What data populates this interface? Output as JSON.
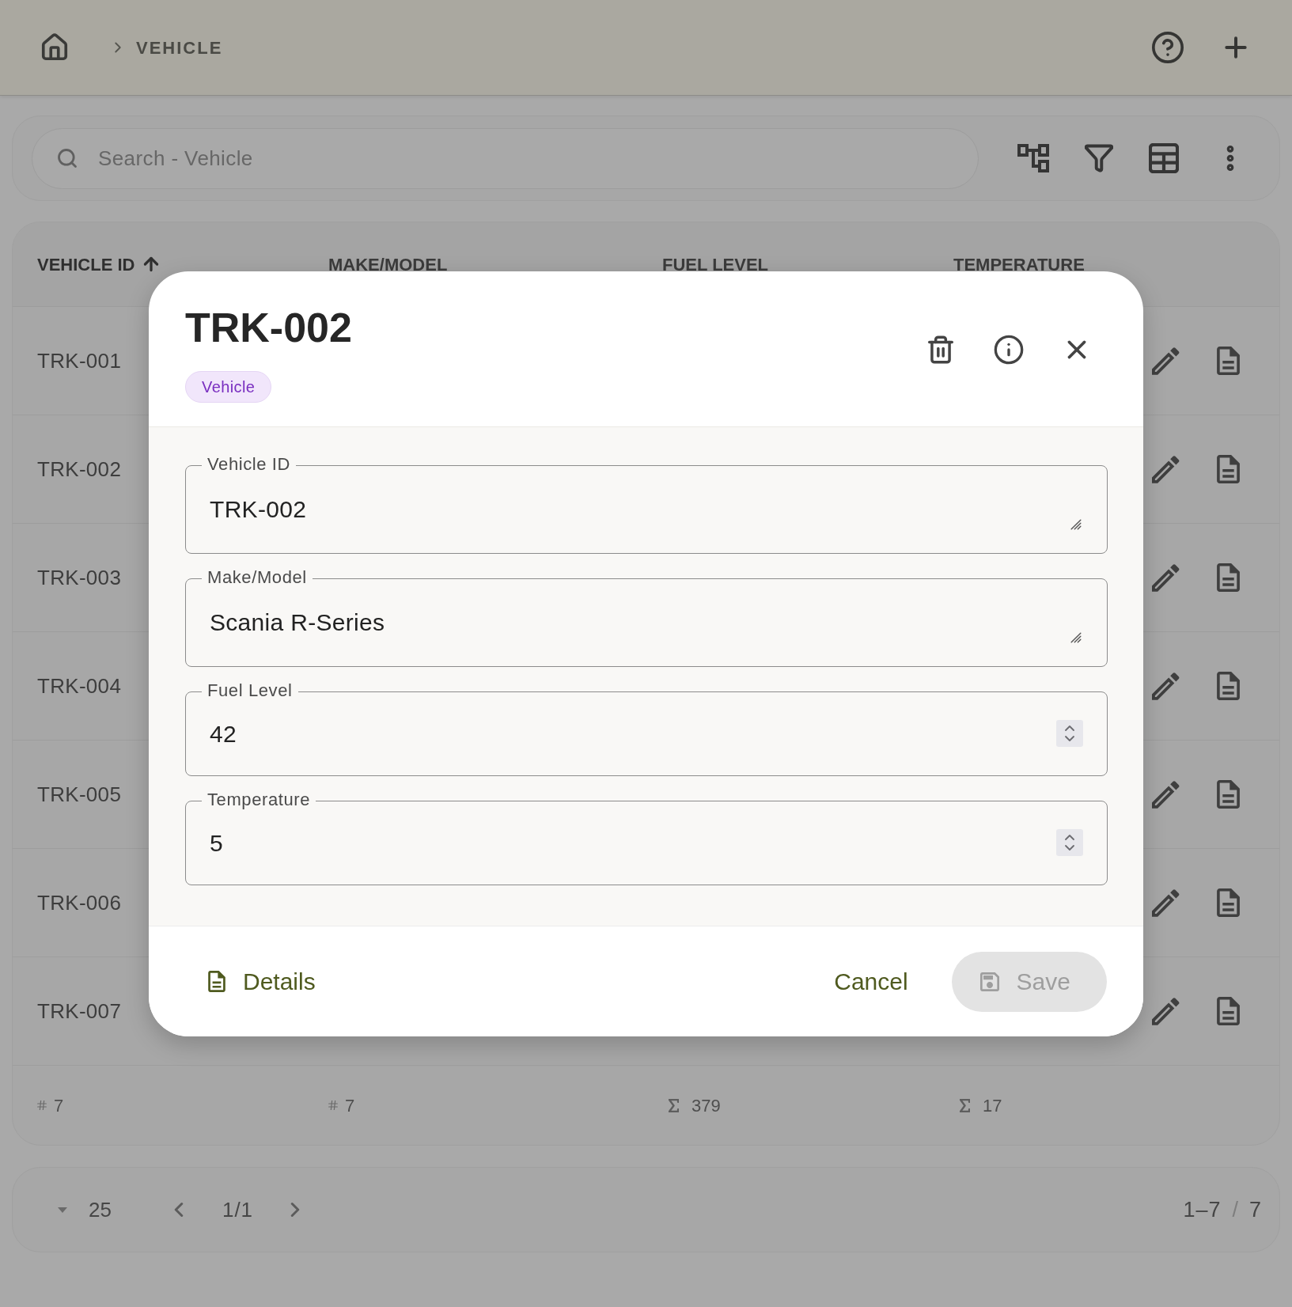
{
  "top_bar": {
    "breadcrumb": [
      {
        "label": "VEHICLE"
      }
    ]
  },
  "toolbar": {
    "search": {
      "placeholder": "Search - Vehicle"
    }
  },
  "table": {
    "columns": [
      {
        "label": "VEHICLE ID",
        "sorted": true
      },
      {
        "label": "MAKE/MODEL",
        "sorted": false
      },
      {
        "label": "FUEL LEVEL",
        "sorted": false
      },
      {
        "label": "TEMPERATURE",
        "sorted": false
      }
    ],
    "rows": [
      {
        "vehicle_id": "TRK-001"
      },
      {
        "vehicle_id": "TRK-002"
      },
      {
        "vehicle_id": "TRK-003"
      },
      {
        "vehicle_id": "TRK-004"
      },
      {
        "vehicle_id": "TRK-005"
      },
      {
        "vehicle_id": "TRK-006"
      },
      {
        "vehicle_id": "TRK-007"
      }
    ],
    "footer": [
      {
        "kind": "count",
        "value": "7"
      },
      {
        "kind": "count",
        "value": "7"
      },
      {
        "kind": "sum",
        "value": "379"
      },
      {
        "kind": "sum",
        "value": "17"
      }
    ]
  },
  "pagination": {
    "page_size": "25",
    "page": "1/1",
    "range": "1–7",
    "separator": "/",
    "total": "7"
  },
  "dialog": {
    "title": "TRK-002",
    "badge": "Vehicle",
    "fields": [
      {
        "kind": "textarea",
        "label": "Vehicle ID",
        "value": "TRK-002"
      },
      {
        "kind": "textarea",
        "label": "Make/Model",
        "value": "Scania R-Series"
      },
      {
        "kind": "number",
        "label": "Fuel Level",
        "value": "42"
      },
      {
        "kind": "number",
        "label": "Temperature",
        "value": "5"
      }
    ],
    "buttons": [
      {
        "kind": "link",
        "label": "Details",
        "disabled": false
      },
      {
        "kind": "text",
        "label": "Cancel",
        "disabled": false
      },
      {
        "kind": "primary",
        "label": "Save",
        "disabled": true
      }
    ]
  }
}
